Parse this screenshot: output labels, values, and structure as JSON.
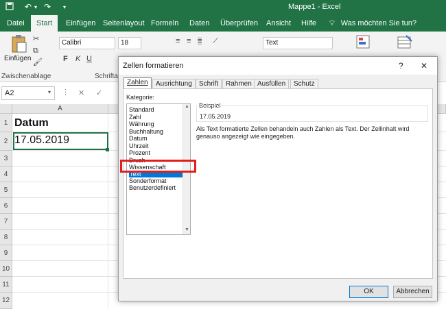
{
  "window": {
    "title": "Mappe1  -  Excel",
    "brand_color": "#217346"
  },
  "quick_access": {
    "save_icon": "save-icon",
    "undo_icon": "undo-icon",
    "redo_icon": "redo-icon",
    "customize_icon": "customize-icon"
  },
  "ribbon_tabs": [
    {
      "label": "Datei"
    },
    {
      "label": "Start"
    },
    {
      "label": "Einfügen"
    },
    {
      "label": "Seitenlayout"
    },
    {
      "label": "Formeln"
    },
    {
      "label": "Daten"
    },
    {
      "label": "Überprüfen"
    },
    {
      "label": "Ansicht"
    },
    {
      "label": "Hilfe"
    }
  ],
  "tell_me": {
    "label": "Was möchten Sie tun?",
    "icon": "lightbulb-icon"
  },
  "ribbon": {
    "paste_label": "Einfügen",
    "clipboard_group": "Zwischenablage",
    "font_group": "Schriftart",
    "font_name": "Calibri",
    "font_size": "18",
    "bold": "F",
    "italic": "K",
    "underline": "U",
    "number_format": "Text"
  },
  "formula_bar": {
    "name_box": "A2",
    "cancel": "✕",
    "enter": "✓",
    "fx": "fx"
  },
  "grid": {
    "column_a": "A",
    "rows": [
      "1",
      "2",
      "3",
      "4",
      "5",
      "6",
      "7",
      "8",
      "9",
      "10",
      "11",
      "12"
    ],
    "a1": "Datum",
    "a2": "17.05.2019"
  },
  "dialog": {
    "title": "Zellen formatieren",
    "help": "?",
    "close": "✕",
    "tabs": [
      {
        "label": "Zahlen"
      },
      {
        "label": "Ausrichtung"
      },
      {
        "label": "Schrift"
      },
      {
        "label": "Rahmen"
      },
      {
        "label": "Ausfüllen"
      },
      {
        "label": "Schutz"
      }
    ],
    "kategorie_label": "Kategorie:",
    "categories": [
      "Standard",
      "Zahl",
      "Währung",
      "Buchhaltung",
      "Datum",
      "Uhrzeit",
      "Prozent",
      "Bruch",
      "Wissenschaft",
      "Text",
      "Sonderformat",
      "Benutzerdefiniert"
    ],
    "selected_category": "Text",
    "beispiel_label": "Beispiel",
    "beispiel_value": "17.05.2019",
    "description": "Als Text formatierte Zellen behandeln auch Zahlen als Text. Der Zellinhalt wird genauso angezeigt wie eingegeben.",
    "ok": "OK",
    "cancel": "Abbrechen",
    "highlight_color": "#e01e1e",
    "selection_color": "#0078d7"
  }
}
